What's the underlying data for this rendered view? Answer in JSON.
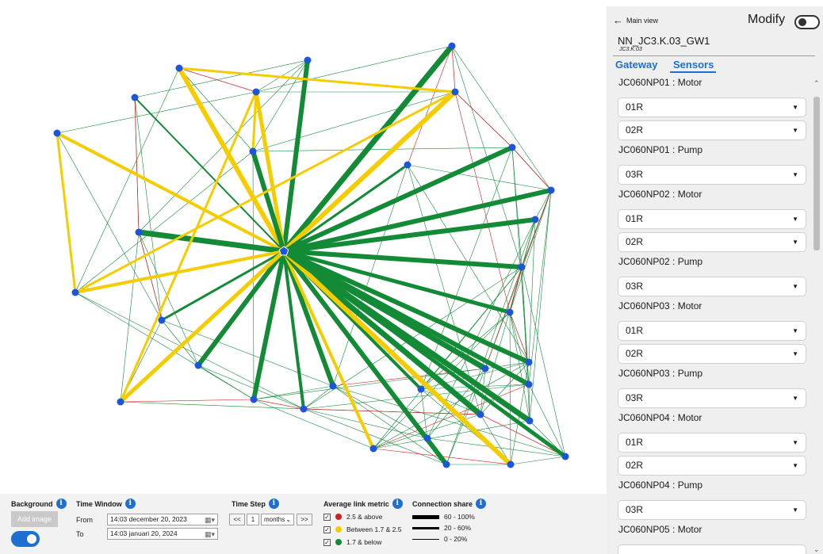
{
  "panel": {
    "back_label": "Main view",
    "modify_label": "Modify",
    "gateway_name": "NN_JC3.K.03_GW1",
    "gateway_sub": "JC3.K.03",
    "tabs": [
      "Gateway",
      "Sensors"
    ],
    "active_tab": "Sensors",
    "groups": [
      {
        "title": "JC060NP01 : Motor",
        "sensors": [
          "01R",
          "02R"
        ]
      },
      {
        "title": "JC060NP01 : Pump",
        "sensors": [
          "03R"
        ]
      },
      {
        "title": "JC060NP02 : Motor",
        "sensors": [
          "01R",
          "02R"
        ]
      },
      {
        "title": "JC060NP02 : Pump",
        "sensors": [
          "03R"
        ]
      },
      {
        "title": "JC060NP03 : Motor",
        "sensors": [
          "01R",
          "02R"
        ]
      },
      {
        "title": "JC060NP03 : Pump",
        "sensors": [
          "03R"
        ]
      },
      {
        "title": "JC060NP04 : Motor",
        "sensors": [
          "01R",
          "02R"
        ]
      },
      {
        "title": "JC060NP04 : Pump",
        "sensors": [
          "03R"
        ]
      },
      {
        "title": "JC060NP05 : Motor",
        "sensors": []
      }
    ]
  },
  "controls": {
    "background_label": "Background",
    "add_image_label": "Add image",
    "time_window_label": "Time Window",
    "from_label": "From",
    "to_label": "To",
    "from_value": "14:03 december 20, 2023",
    "to_value": "14:03  januari  20, 2024",
    "time_step_label": "Time Step",
    "step_prev": "<<",
    "step_value": "1",
    "step_unit": "months",
    "step_next": ">>",
    "metric_label": "Average link metric",
    "metric_items": [
      {
        "label": "2.5 & above",
        "color": "#d31f1f"
      },
      {
        "label": "Between 1.7 & 2.5",
        "color": "#f5cc00"
      },
      {
        "label": "1.7 & below",
        "color": "#138a36"
      }
    ],
    "share_label": "Connection share",
    "share_items": [
      "60 - 100%",
      "20 - 60%",
      "0 - 20%"
    ]
  },
  "colors": {
    "accent": "#1f6fd1",
    "node": "#1c55d8",
    "green": "#138a36",
    "yellow": "#f5cc00",
    "red": "#d31f1f"
  }
}
